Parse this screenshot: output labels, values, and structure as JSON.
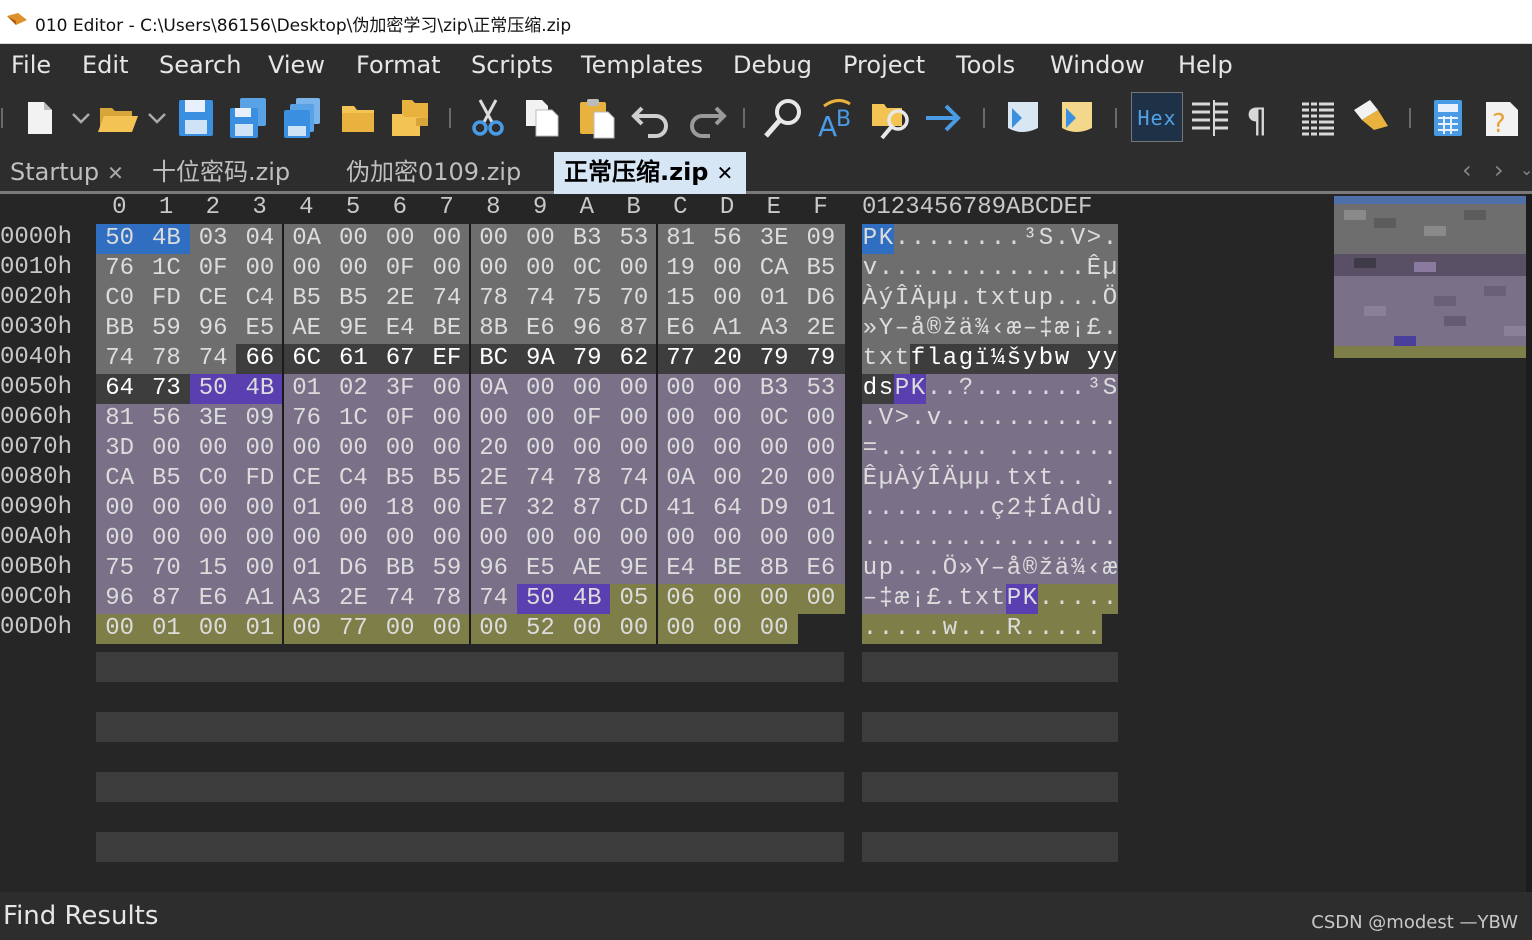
{
  "window": {
    "title": "010 Editor - C:\\Users\\86156\\Desktop\\伪加密学习\\zip\\正常压缩.zip"
  },
  "menu": [
    "File",
    "Edit",
    "Search",
    "View",
    "Format",
    "Scripts",
    "Templates",
    "Debug",
    "Project",
    "Tools",
    "Window",
    "Help"
  ],
  "toolbar": {
    "buttons": [
      "new-file-icon",
      "open-file-icon",
      "save-icon",
      "save-as-icon",
      "save-all-icon",
      "folder-icon",
      "open-project-icon",
      "cut-icon",
      "copy-icon",
      "paste-icon",
      "undo-icon",
      "redo-icon",
      "find-icon",
      "replace-icon",
      "find-in-files-icon",
      "goto-icon",
      "run-script-icon",
      "run-template-icon",
      "hex-mode-button",
      "columns-icon",
      "show-whitespace-icon",
      "list-icon",
      "highlight-icon",
      "calculator-icon",
      "help-icon"
    ],
    "hex_label": "Hex"
  },
  "tabs": [
    {
      "label": "Startup",
      "close": "✕",
      "active": false
    },
    {
      "label": "十位密码.zip",
      "active": false
    },
    {
      "label": "伪加密0109.zip",
      "active": false
    },
    {
      "label": "正常压缩.zip",
      "close": "✕",
      "active": true
    }
  ],
  "tab_nav": {
    "prev": "‹",
    "next": "›"
  },
  "hex": {
    "column_headers": [
      "0",
      "1",
      "2",
      "3",
      "4",
      "5",
      "6",
      "7",
      "8",
      "9",
      "A",
      "B",
      "C",
      "D",
      "E",
      "F"
    ],
    "ascii_header": "0123456789ABCDEF",
    "rows": [
      {
        "addr": "0000h",
        "bytes": [
          "50",
          "4B",
          "03",
          "04",
          "0A",
          "00",
          "00",
          "00",
          "00",
          "00",
          "B3",
          "53",
          "81",
          "56",
          "3E",
          "09"
        ],
        "ascii": [
          "P",
          "K",
          ".",
          ".",
          ".",
          ".",
          ".",
          ".",
          ".",
          ".",
          "³",
          "S",
          ".",
          "V",
          ">",
          "."
        ]
      },
      {
        "addr": "0010h",
        "bytes": [
          "76",
          "1C",
          "0F",
          "00",
          "00",
          "00",
          "0F",
          "00",
          "00",
          "00",
          "0C",
          "00",
          "19",
          "00",
          "CA",
          "B5"
        ],
        "ascii": [
          "v",
          ".",
          ".",
          ".",
          ".",
          ".",
          ".",
          ".",
          ".",
          ".",
          ".",
          ".",
          ".",
          ".",
          "Ê",
          "µ"
        ]
      },
      {
        "addr": "0020h",
        "bytes": [
          "C0",
          "FD",
          "CE",
          "C4",
          "B5",
          "B5",
          "2E",
          "74",
          "78",
          "74",
          "75",
          "70",
          "15",
          "00",
          "01",
          "D6"
        ],
        "ascii": [
          "À",
          "ý",
          "Î",
          "Ä",
          "µ",
          "µ",
          ".",
          "t",
          "x",
          "t",
          "u",
          "p",
          ".",
          ".",
          ".",
          "Ö"
        ]
      },
      {
        "addr": "0030h",
        "bytes": [
          "BB",
          "59",
          "96",
          "E5",
          "AE",
          "9E",
          "E4",
          "BE",
          "8B",
          "E6",
          "96",
          "87",
          "E6",
          "A1",
          "A3",
          "2E"
        ],
        "ascii": [
          "»",
          "Y",
          "–",
          "å",
          "®",
          "ž",
          "ä",
          "¾",
          "‹",
          "æ",
          "–",
          "‡",
          "æ",
          "¡",
          "£",
          "."
        ]
      },
      {
        "addr": "0040h",
        "bytes": [
          "74",
          "78",
          "74",
          "66",
          "6C",
          "61",
          "67",
          "EF",
          "BC",
          "9A",
          "79",
          "62",
          "77",
          "20",
          "79",
          "79"
        ],
        "ascii": [
          "t",
          "x",
          "t",
          "f",
          "l",
          "a",
          "g",
          "ï",
          "¼",
          "š",
          "y",
          "b",
          "w",
          " ",
          "y",
          "y"
        ]
      },
      {
        "addr": "0050h",
        "bytes": [
          "64",
          "73",
          "50",
          "4B",
          "01",
          "02",
          "3F",
          "00",
          "0A",
          "00",
          "00",
          "00",
          "00",
          "00",
          "B3",
          "53"
        ],
        "ascii": [
          "d",
          "s",
          "P",
          "K",
          ".",
          ".",
          "?",
          ".",
          ".",
          ".",
          ".",
          ".",
          ".",
          ".",
          "³",
          "S"
        ]
      },
      {
        "addr": "0060h",
        "bytes": [
          "81",
          "56",
          "3E",
          "09",
          "76",
          "1C",
          "0F",
          "00",
          "00",
          "00",
          "0F",
          "00",
          "00",
          "00",
          "0C",
          "00"
        ],
        "ascii": [
          ".",
          "V",
          ">",
          ".",
          "v",
          ".",
          ".",
          ".",
          ".",
          ".",
          ".",
          ".",
          ".",
          ".",
          ".",
          "."
        ]
      },
      {
        "addr": "0070h",
        "bytes": [
          "3D",
          "00",
          "00",
          "00",
          "00",
          "00",
          "00",
          "00",
          "20",
          "00",
          "00",
          "00",
          "00",
          "00",
          "00",
          "00"
        ],
        "ascii": [
          "=",
          ".",
          ".",
          ".",
          ".",
          ".",
          ".",
          ".",
          " ",
          ".",
          ".",
          ".",
          ".",
          ".",
          ".",
          "."
        ]
      },
      {
        "addr": "0080h",
        "bytes": [
          "CA",
          "B5",
          "C0",
          "FD",
          "CE",
          "C4",
          "B5",
          "B5",
          "2E",
          "74",
          "78",
          "74",
          "0A",
          "00",
          "20",
          "00"
        ],
        "ascii": [
          "Ê",
          "µ",
          "À",
          "ý",
          "Î",
          "Ä",
          "µ",
          "µ",
          ".",
          "t",
          "x",
          "t",
          ".",
          ".",
          " ",
          "."
        ]
      },
      {
        "addr": "0090h",
        "bytes": [
          "00",
          "00",
          "00",
          "00",
          "01",
          "00",
          "18",
          "00",
          "E7",
          "32",
          "87",
          "CD",
          "41",
          "64",
          "D9",
          "01"
        ],
        "ascii": [
          ".",
          ".",
          ".",
          ".",
          ".",
          ".",
          ".",
          ".",
          "ç",
          "2",
          "‡",
          "Í",
          "A",
          "d",
          "Ù",
          "."
        ]
      },
      {
        "addr": "00A0h",
        "bytes": [
          "00",
          "00",
          "00",
          "00",
          "00",
          "00",
          "00",
          "00",
          "00",
          "00",
          "00",
          "00",
          "00",
          "00",
          "00",
          "00"
        ],
        "ascii": [
          ".",
          ".",
          ".",
          ".",
          ".",
          ".",
          ".",
          ".",
          ".",
          ".",
          ".",
          ".",
          ".",
          ".",
          ".",
          "."
        ]
      },
      {
        "addr": "00B0h",
        "bytes": [
          "75",
          "70",
          "15",
          "00",
          "01",
          "D6",
          "BB",
          "59",
          "96",
          "E5",
          "AE",
          "9E",
          "E4",
          "BE",
          "8B",
          "E6"
        ],
        "ascii": [
          "u",
          "p",
          ".",
          ".",
          ".",
          "Ö",
          "»",
          "Y",
          "–",
          "å",
          "®",
          "ž",
          "ä",
          "¾",
          "‹",
          "æ"
        ]
      },
      {
        "addr": "00C0h",
        "bytes": [
          "96",
          "87",
          "E6",
          "A1",
          "A3",
          "2E",
          "74",
          "78",
          "74",
          "50",
          "4B",
          "05",
          "06",
          "00",
          "00",
          "00"
        ],
        "ascii": [
          "–",
          "‡",
          "æ",
          "¡",
          "£",
          ".",
          "t",
          "x",
          "t",
          "P",
          "K",
          ".",
          ".",
          ".",
          ".",
          "."
        ]
      },
      {
        "addr": "00D0h",
        "bytes": [
          "00",
          "01",
          "00",
          "01",
          "00",
          "77",
          "00",
          "00",
          "00",
          "52",
          "00",
          "00",
          "00",
          "00",
          "00"
        ],
        "ascii": [
          ".",
          ".",
          ".",
          ".",
          ".",
          "w",
          ".",
          ".",
          ".",
          "R",
          ".",
          ".",
          ".",
          ".",
          "."
        ]
      }
    ]
  },
  "colors": {
    "header_region": "#6e6e6e",
    "file_data_region": "#3d3d3d",
    "central_dir_region": "#7a7088",
    "end_record_region": "#7e7e48",
    "signature_blue": "#2f6ec0",
    "signature_purple": "#5a3fb0",
    "file_data_text": "#ffffff"
  },
  "find_results": {
    "label": "Find Results"
  },
  "watermark": "CSDN @modest —YBW"
}
